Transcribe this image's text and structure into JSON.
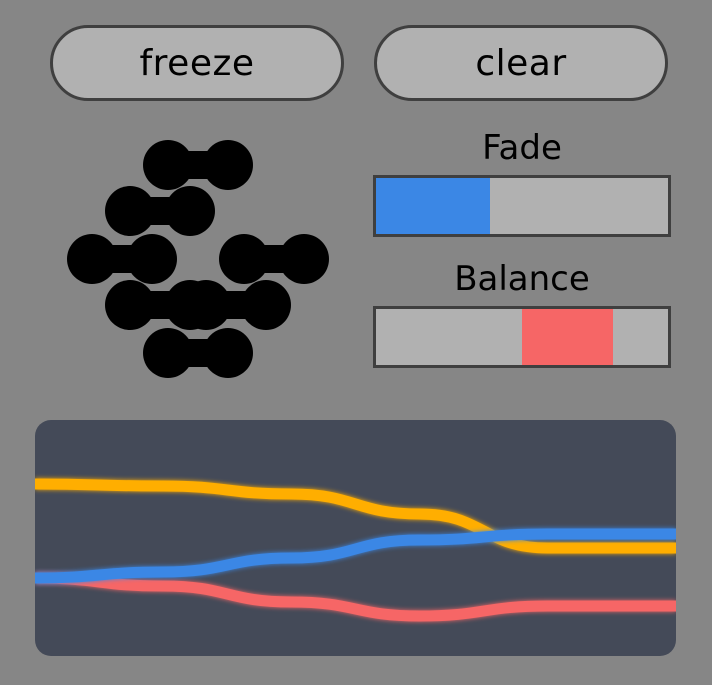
{
  "buttons": {
    "freeze_label": "freeze",
    "clear_label": "clear"
  },
  "sliders": {
    "fade": {
      "label": "Fade",
      "fill_start": 0.0,
      "fill_end": 0.39,
      "color": "#3b87e5"
    },
    "balance": {
      "label": "Balance",
      "fill_start": 0.5,
      "fill_end": 0.81,
      "color": "#f66666"
    }
  },
  "logo": {
    "icon": "linked-dots-logo-icon",
    "color": "#000000"
  },
  "graph": {
    "background": "#444a58",
    "lines": [
      {
        "name": "orange-line",
        "color": "#ffae00",
        "values": [
          0.77,
          0.76,
          0.72,
          0.62,
          0.45,
          0.45
        ]
      },
      {
        "name": "red-line",
        "color": "#f66666",
        "values": [
          0.3,
          0.26,
          0.18,
          0.11,
          0.16,
          0.16
        ]
      },
      {
        "name": "blue-line",
        "color": "#3b87e5",
        "values": [
          0.3,
          0.33,
          0.4,
          0.49,
          0.52,
          0.52
        ]
      }
    ]
  }
}
